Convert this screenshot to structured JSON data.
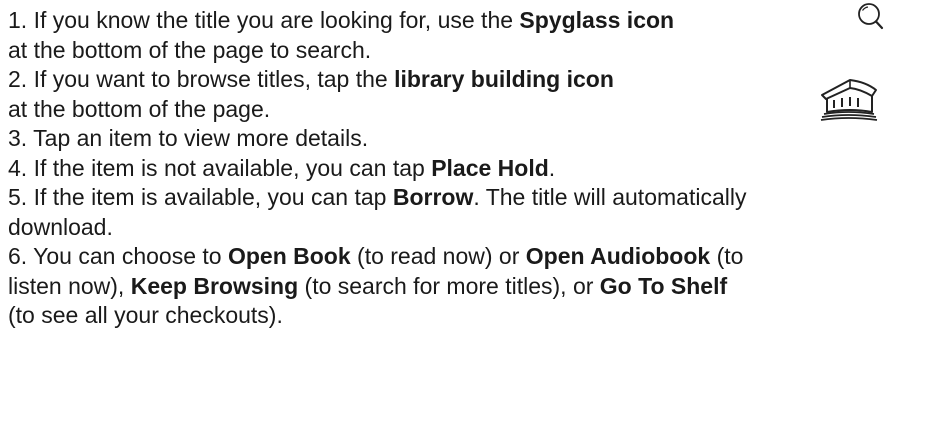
{
  "icons": {
    "spyglass": "search-icon",
    "library": "library-building-icon"
  },
  "lines": [
    {
      "pre": "1. If you know the title you are looking for, use the ",
      "b1": "Spyglass icon",
      "post": ""
    },
    {
      "pre": "at the bottom of the page to search.",
      "b1": "",
      "post": ""
    },
    {
      "pre": "2. If you want to browse titles, tap the ",
      "b1": "library building icon",
      "post": ""
    },
    {
      "pre": " at the bottom of the page.",
      "b1": "",
      "post": ""
    },
    {
      "pre": "3. Tap an item to view more details.",
      "b1": "",
      "post": ""
    },
    {
      "pre": "4. If the item is not available, you can tap ",
      "b1": "Place Hold",
      "post": "."
    },
    {
      "pre": "5. If the item is available, you can tap ",
      "b1": "Borrow",
      "post": ". The title will automatically"
    },
    {
      "pre": "download.",
      "b1": "",
      "post": ""
    },
    {
      "pre": "6. You can choose to ",
      "b1": "Open Book",
      "mid1": " (to read now) or ",
      "b2": "Open Audiobook",
      "post": " (to"
    },
    {
      "pre": "listen now), ",
      "b1": "Keep Browsing",
      "mid1": " (to search for more titles), or ",
      "b2": "Go To Shelf",
      "post": ""
    },
    {
      "pre": "(to see all your checkouts).",
      "b1": "",
      "post": ""
    }
  ]
}
